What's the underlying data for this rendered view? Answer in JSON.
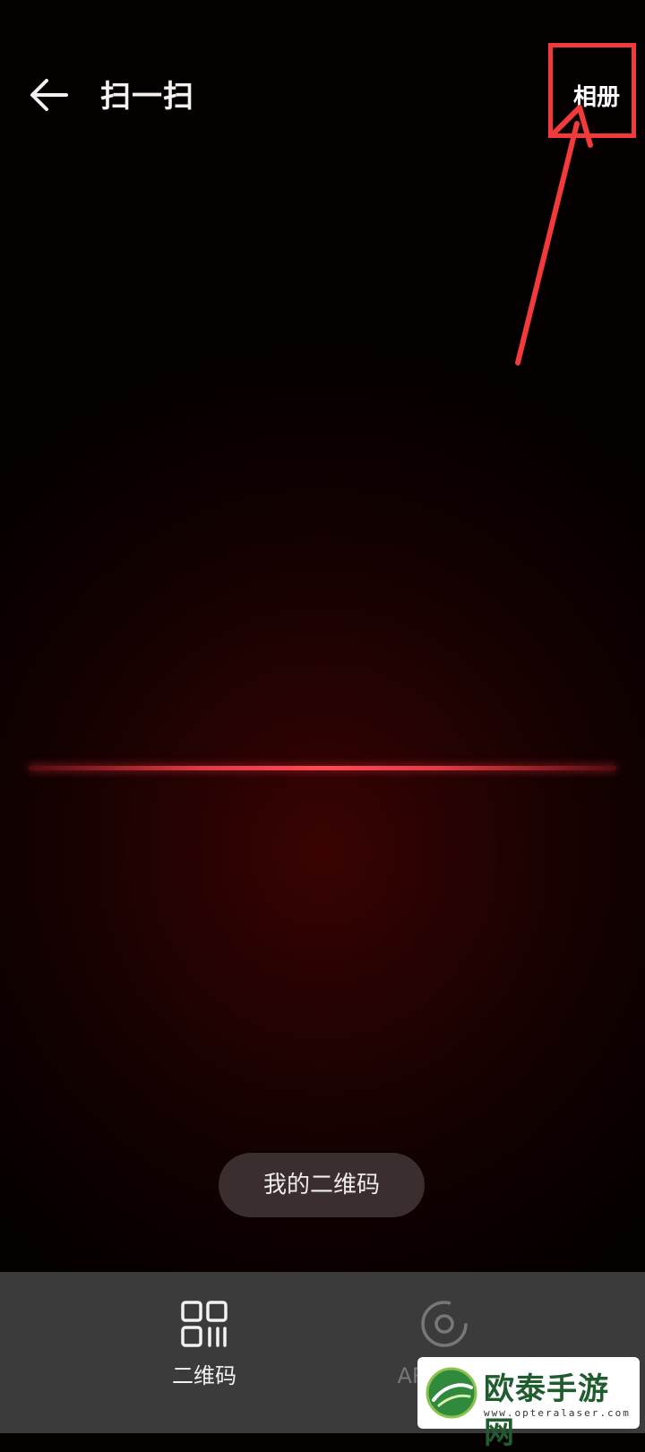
{
  "header": {
    "title": "扫一扫",
    "album_label": "相册"
  },
  "scanner": {
    "my_qr_label": "我的二维码"
  },
  "bottom_tabs": [
    {
      "label": "二维码",
      "icon": "qr-code-icon",
      "active": true
    },
    {
      "label": "AR扫一扫",
      "icon": "ar-scan-icon",
      "active": false
    }
  ],
  "watermark": {
    "brand": "欧泰手游网",
    "url": "www.opteralaser.com"
  },
  "colors": {
    "annotation_red": "#f23a3a",
    "scan_line": "#ff4a55",
    "bottom_bar": "#3b3b3b"
  }
}
